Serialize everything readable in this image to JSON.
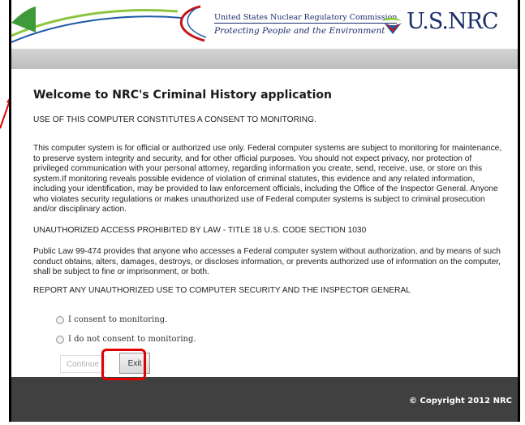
{
  "header": {
    "agency_name": "United States Nuclear Regulatory Commission",
    "tagline": "Protecting People and the Environment",
    "logo_text": "U.S.NRC"
  },
  "main": {
    "title": "Welcome to NRC's Criminal History application",
    "consent_notice": "USE OF THIS COMPUTER CONSTITUTES A CONSENT TO MONITORING.",
    "paragraph_official_use": "This computer system is for official or authorized use only. Federal computer systems are subject to monitoring for maintenance, to preserve system integrity and security, and for other official purposes. You should not expect privacy, nor protection of privileged communication with your personal attorney, regarding information you create, send, receive, use, or store on this system.If monitoring reveals possible evidence of violation of criminal statutes, this evidence and any related information, including your identification, may be provided to law enforcement officials, including the Office of the Inspector General. Anyone who violates security regulations or makes unauthorized use of Federal computer systems is subject to criminal prosecution and/or disciplinary action.",
    "unauthorized_notice": "UNAUTHORIZED ACCESS PROHIBITED BY LAW - TITLE 18 U.S. CODE SECTION 1030",
    "paragraph_public_law": "Public Law 99-474 provides that anyone who accesses a Federal computer system without authorization, and by means of such conduct obtains, alters, damages, destroys, or discloses information, or prevents authorized use of information on the computer, shall be subject to fine or imprisonment, or both.",
    "report_notice": "REPORT ANY UNAUTHORIZED USE TO COMPUTER SECURITY AND THE INSPECTOR GENERAL"
  },
  "consent_options": [
    {
      "label": "I consent to monitoring.",
      "selected": false
    },
    {
      "label": "I do not consent to monitoring.",
      "selected": false
    }
  ],
  "buttons": {
    "continue_label": "Continue",
    "continue_disabled": true,
    "exit_label": "Exit"
  },
  "footer": {
    "copyright": "© Copyright 2012 NRC"
  },
  "colors": {
    "brand_navy": "#1c2d6b",
    "swoosh_green": "#8cc63f",
    "swoosh_blue": "#1e5ba8",
    "swoosh_red": "#c4161c",
    "footer_bg": "#404040",
    "highlight_red": "#e00000"
  }
}
